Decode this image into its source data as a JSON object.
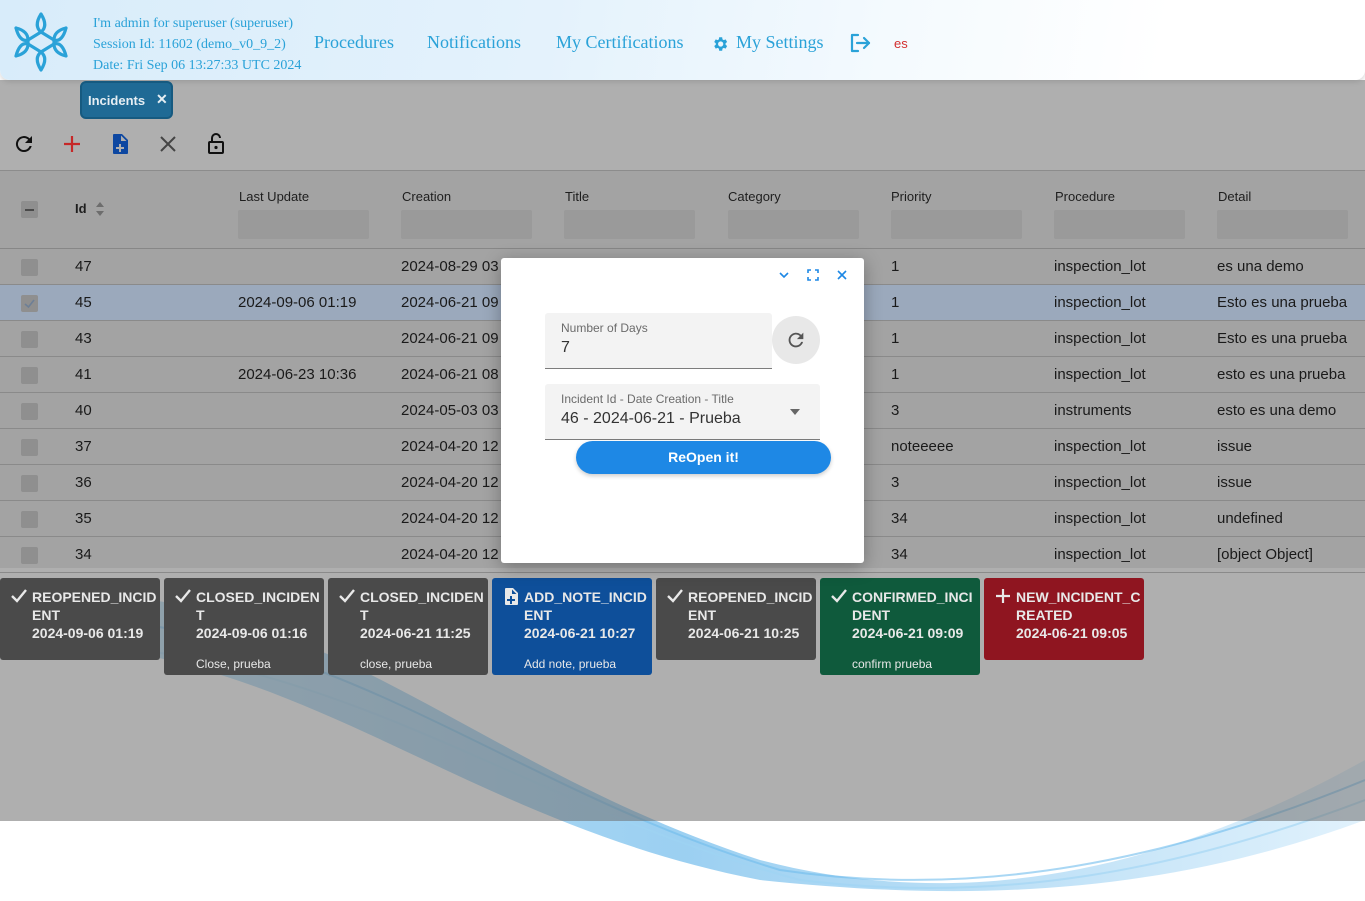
{
  "header": {
    "session_line1": "I'm admin for superuser (superuser)",
    "session_line2": "Session Id: 11602 (demo_v0_9_2)",
    "session_line3": "Date: Fri Sep 06 13:27:33 UTC 2024",
    "nav": {
      "procedures": "Procedures",
      "notifications": "Notifications",
      "certifications": "My Certifications",
      "settings": "My Settings"
    },
    "lang": "es",
    "colors": {
      "link": "#2aa2d8",
      "lang": "#d32f2f"
    }
  },
  "tab": {
    "label": "Incidents",
    "close": "✕"
  },
  "toolbar": {
    "icons": [
      "refresh-icon",
      "add-icon",
      "add-note-icon",
      "close-icon",
      "unlock-icon"
    ]
  },
  "grid": {
    "columns": {
      "id": "Id",
      "last_update": "Last Update",
      "creation": "Creation",
      "title": "Title",
      "category": "Category",
      "priority": "Priority",
      "procedure": "Procedure",
      "detail": "Detail"
    },
    "rows": [
      {
        "id": "47",
        "last_update": "",
        "creation": "2024-08-29 03",
        "priority": "1",
        "procedure": "inspection_lot",
        "detail": "es una demo"
      },
      {
        "id": "45",
        "last_update": "2024-09-06 01:19",
        "creation": "2024-06-21 09",
        "priority": "1",
        "procedure": "inspection_lot",
        "detail": "Esto es una prueba"
      },
      {
        "id": "43",
        "last_update": "",
        "creation": "2024-06-21 09",
        "priority": "1",
        "procedure": "inspection_lot",
        "detail": "Esto es una prueba"
      },
      {
        "id": "41",
        "last_update": "2024-06-23 10:36",
        "creation": "2024-06-21 08",
        "priority": "1",
        "procedure": "inspection_lot",
        "detail": "esto es una prueba"
      },
      {
        "id": "40",
        "last_update": "",
        "creation": "2024-05-03 03",
        "priority": "3",
        "procedure": "instruments",
        "detail": "esto es una demo"
      },
      {
        "id": "37",
        "last_update": "",
        "creation": "2024-04-20 12",
        "priority": "noteeeee",
        "procedure": "inspection_lot",
        "detail": "issue"
      },
      {
        "id": "36",
        "last_update": "",
        "creation": "2024-04-20 12",
        "priority": "3",
        "procedure": "inspection_lot",
        "detail": "issue"
      },
      {
        "id": "35",
        "last_update": "",
        "creation": "2024-04-20 12",
        "priority": "34",
        "procedure": "inspection_lot",
        "detail": "undefined"
      },
      {
        "id": "34",
        "last_update": "",
        "creation": "2024-04-20 12",
        "priority": "34",
        "procedure": "inspection_lot",
        "detail": "[object Object]"
      }
    ]
  },
  "events": [
    {
      "title": "REOPENED_INCIDENT",
      "date": "2024-09-06 01:19",
      "note": "",
      "icon": "check-icon",
      "color": "#4a4a4a"
    },
    {
      "title": "CLOSED_INCIDENT",
      "date": "2024-09-06 01:16",
      "note": "Close, prueba",
      "icon": "check-icon",
      "color": "#4a4a4a"
    },
    {
      "title": "CLOSED_INCIDENT",
      "date": "2024-06-21 11:25",
      "note": "close, prueba",
      "icon": "check-icon",
      "color": "#4a4a4a"
    },
    {
      "title": "ADD_NOTE_INCIDENT",
      "date": "2024-06-21 10:27",
      "note": "Add note, prueba",
      "icon": "note-icon",
      "color": "#0e4f9a"
    },
    {
      "title": "REOPENED_INCIDENT",
      "date": "2024-06-21 10:25",
      "note": "",
      "icon": "check-icon",
      "color": "#4a4a4a"
    },
    {
      "title": "CONFIRMED_INCIDENT",
      "date": "2024-06-21 09:09",
      "note": "confirm prueba",
      "icon": "check-icon",
      "color": "#0f5a3c"
    },
    {
      "title": "NEW_INCIDENT_CREATED",
      "date": "2024-06-21 09:05",
      "note": "",
      "icon": "plus-icon",
      "color": "#8f1520"
    }
  ],
  "modal": {
    "days_label": "Number of Days",
    "days_value": "7",
    "incident_label": "Incident Id - Date Creation - Title",
    "incident_value": "46 - 2024-06-21 - Prueba",
    "button": "ReOpen it!",
    "colors": {
      "button": "#1e88e5"
    }
  }
}
